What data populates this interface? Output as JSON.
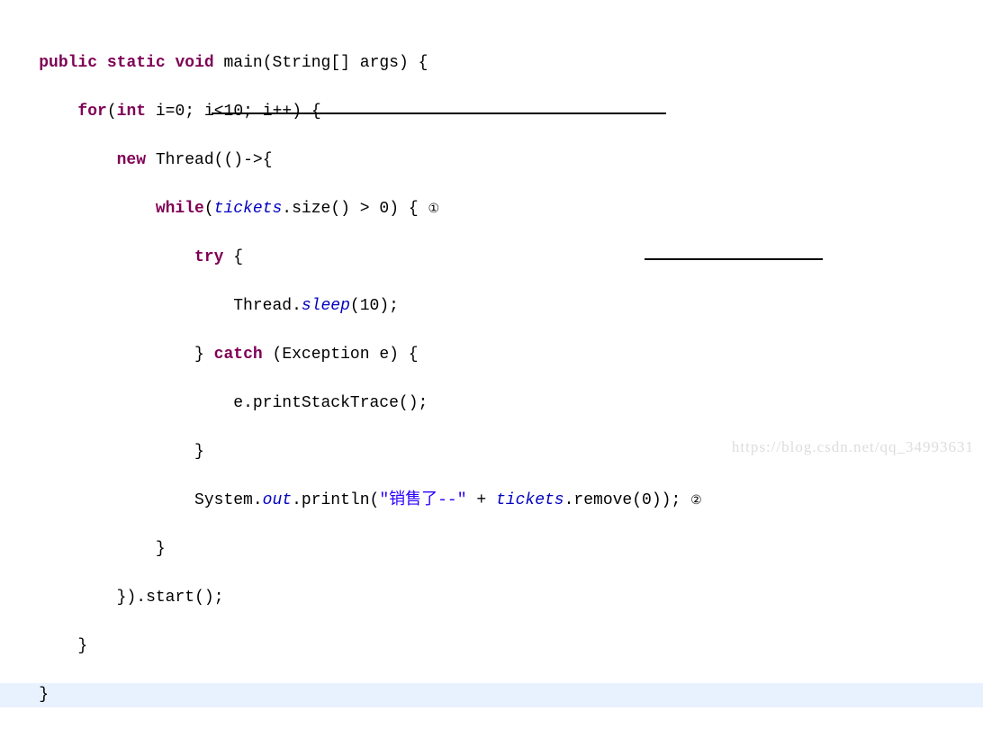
{
  "code": {
    "l1_kw1": "public",
    "l1_kw2": "static",
    "l1_kw3": "void",
    "l1_method": "main",
    "l1_type": "String",
    "l1_brackets": "[]",
    "l1_arg": "args",
    "l2_kw1": "for",
    "l2_kw2": "int",
    "l2_var": "i",
    "l2_eq": "=",
    "l2_n0": "0",
    "l2_lt": "<",
    "l2_n10": "10",
    "l2_inc": "++",
    "l3_kw": "new",
    "l3_type": "Thread",
    "l3_arrow": "->",
    "l4_kw": "while",
    "l4_field": "tickets",
    "l4_method": "size",
    "l4_gt": ">",
    "l4_n0": "0",
    "l5_kw": "try",
    "l6_type": "Thread",
    "l6_method": "sleep",
    "l6_n": "10",
    "l7_kw": "catch",
    "l7_type": "Exception",
    "l7_var": "e",
    "l8_var": "e",
    "l8_method": "printStackTrace",
    "l10_type": "System",
    "l10_out": "out",
    "l10_println": "println",
    "l10_str": "\"销售了--\"",
    "l10_plus": "+",
    "l10_field": "tickets",
    "l10_remove": "remove",
    "l10_n": "0",
    "l12_start": "start",
    "markers": {
      "m1": "①",
      "m2": "②"
    }
  },
  "watermark": "https://blog.csdn.net/qq_34993631"
}
